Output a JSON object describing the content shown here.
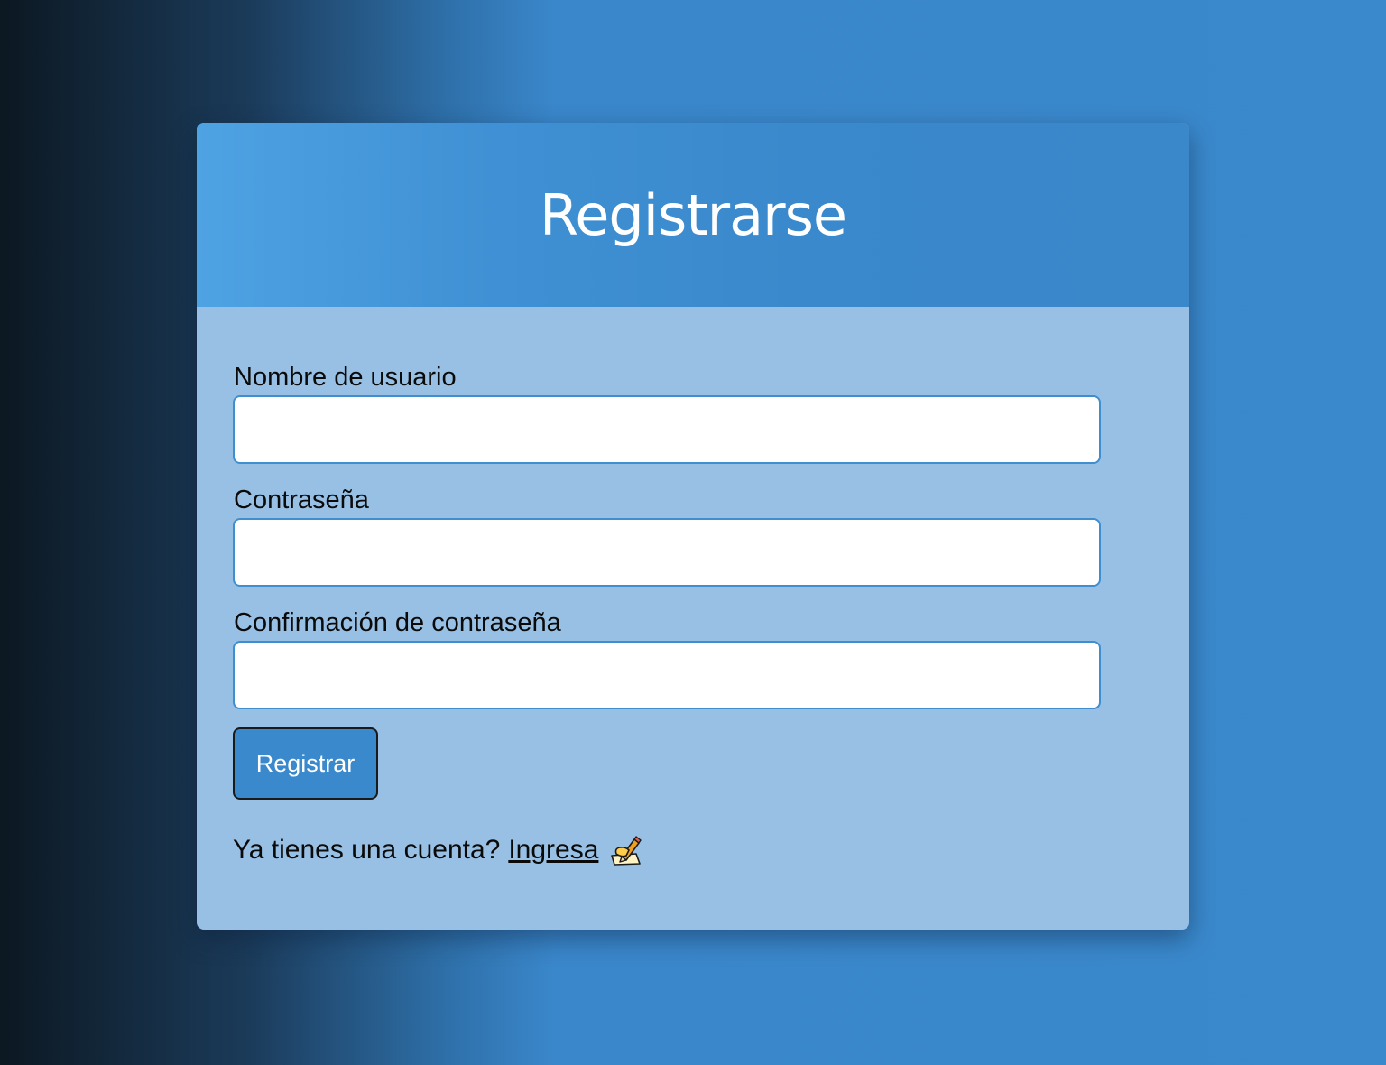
{
  "page": {
    "accent_color": "#3a89cc",
    "card_body_color": "#97c0e4"
  },
  "form": {
    "title": "Registrarse",
    "fields": [
      {
        "label": "Nombre de usuario",
        "value": "",
        "placeholder": ""
      },
      {
        "label": "Contraseña",
        "value": "",
        "placeholder": ""
      },
      {
        "label": "Confirmación de contraseña",
        "value": "",
        "placeholder": ""
      }
    ],
    "submit_label": "Registrar",
    "login_prompt": "Ya tienes una cuenta?",
    "login_link": "Ingresa",
    "login_icon": "writing-hand-icon"
  }
}
